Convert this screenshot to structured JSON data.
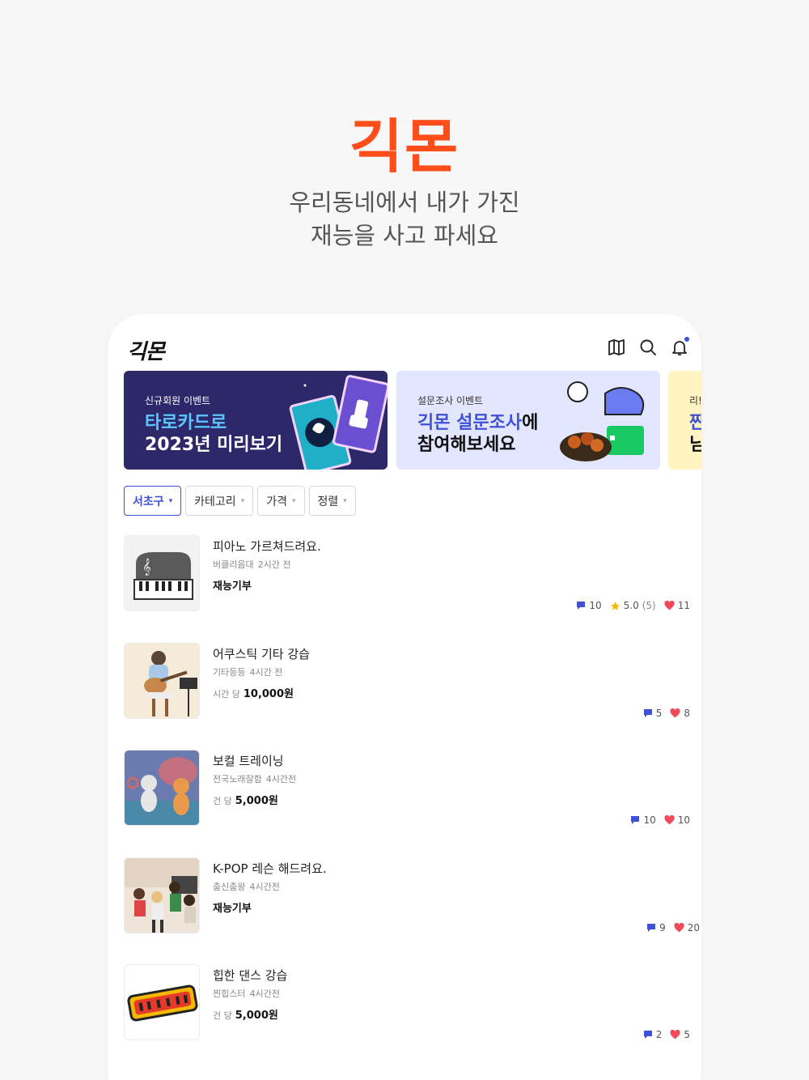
{
  "hero": {
    "title": "긱몬",
    "subtitle_line1": "우리동네에서 내가 가진",
    "subtitle_line2": "재능을 사고 파세요"
  },
  "app": {
    "logo": "긱몬",
    "icons": [
      "map-icon",
      "search-icon",
      "bell-icon"
    ]
  },
  "banners": [
    {
      "sub": "신규회원 이벤트",
      "line1": "타로카드로",
      "line2": "2023년 미리보기"
    },
    {
      "sub": "설문조사 이벤트",
      "line1_accent": "긱몬 설문조사",
      "line1_rest": "에",
      "line2": "참여해보세요"
    },
    {
      "sub": "리!",
      "line1": "짠",
      "line2": "님"
    }
  ],
  "filters": [
    {
      "label": "서초구",
      "active": true
    },
    {
      "label": "카테고리",
      "active": false
    },
    {
      "label": "가격",
      "active": false
    },
    {
      "label": "정렬",
      "active": false
    }
  ],
  "items": [
    {
      "title": "피아노 가르쳐드려요.",
      "seller": "버클리음대",
      "time": "2시간 전",
      "price_unit": "",
      "price": "재능기부",
      "comments": "10",
      "rating": "5.0",
      "rating_count": "(5)",
      "likes": "11"
    },
    {
      "title": "어쿠스틱 기타 강습",
      "seller": "기타등등",
      "time": "4시간 전",
      "price_unit": "시간 당",
      "price": "10,000원",
      "comments": "5",
      "likes": "8"
    },
    {
      "title": "보컬 트레이닝",
      "seller": "전국노래잘함",
      "time": "4시간전",
      "price_unit": "건 당",
      "price": "5,000원",
      "comments": "10",
      "likes": "10"
    },
    {
      "title": "K-POP 레슨 해드려요.",
      "seller": "춤신춤왕",
      "time": "4시간전",
      "price_unit": "",
      "price": "재능기부",
      "comments": "9",
      "likes": "20"
    },
    {
      "title": "힙한 댄스 강습",
      "seller": "찐힙스터",
      "time": "4시간전",
      "price_unit": "건 당",
      "price": "5,000원",
      "comments": "2",
      "likes": "5"
    }
  ],
  "colors": {
    "brand": "#ff4e1a",
    "accent": "#3f51d8",
    "heart": "#f04a5a",
    "star": "#f5b800"
  }
}
